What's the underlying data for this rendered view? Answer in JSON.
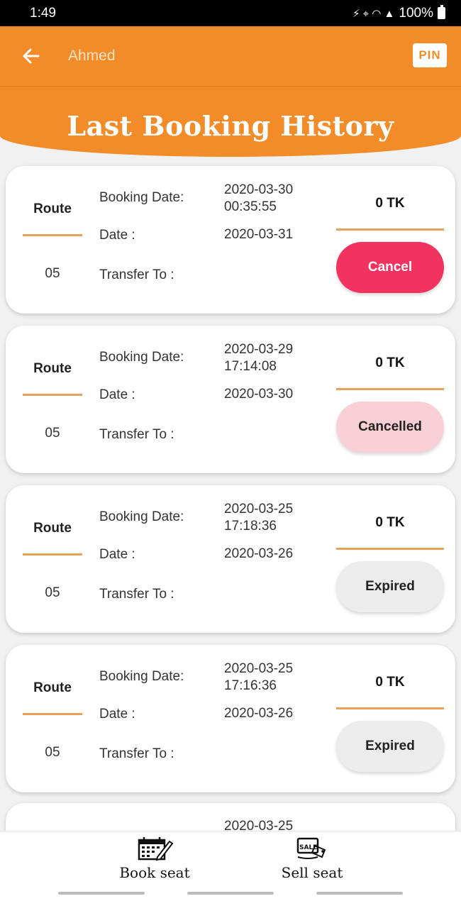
{
  "status_bar": {
    "time": "1:49",
    "icons": "⚡ ⌖ ◠ ▲",
    "battery": "100%"
  },
  "app_bar": {
    "user_name": "Ahmed",
    "pin_label": "PIN"
  },
  "header": {
    "title": "Last Booking History"
  },
  "labels": {
    "route": "Route",
    "booking_date": "Booking Date:",
    "date": "Date :",
    "transfer_to": "Transfer To :"
  },
  "bookings": [
    {
      "route_number": "05",
      "booking_date": "2020-03-30",
      "booking_time": "00:35:55",
      "date": "2020-03-31",
      "price": "0 TK",
      "action": "Cancel"
    },
    {
      "route_number": "05",
      "booking_date": "2020-03-29",
      "booking_time": "17:14:08",
      "date": "2020-03-30",
      "price": "0 TK",
      "action": "Cancelled"
    },
    {
      "route_number": "05",
      "booking_date": "2020-03-25",
      "booking_time": "17:18:36",
      "date": "2020-03-26",
      "price": "0 TK",
      "action": "Expired"
    },
    {
      "route_number": "05",
      "booking_date": "2020-03-25",
      "booking_time": "17:16:36",
      "date": "2020-03-26",
      "price": "0 TK",
      "action": "Expired"
    }
  ],
  "partial_booking": {
    "booking_date": "2020-03-25"
  },
  "bottom_nav": {
    "book_seat": "Book seat",
    "sell_seat": "Sell seat"
  },
  "colors": {
    "primary": "#f28c28",
    "cancel": "#f2325f",
    "cancelled": "#f7cfd4",
    "expired": "#ececec"
  }
}
